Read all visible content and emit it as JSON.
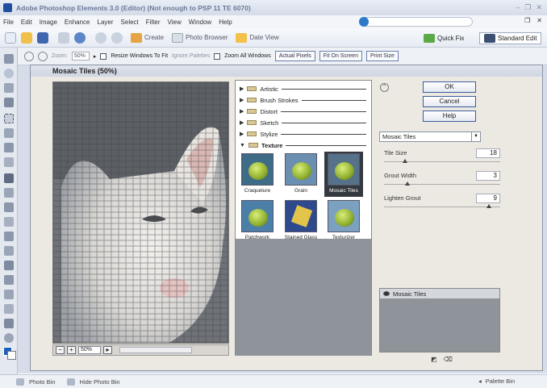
{
  "window": {
    "title": "Adobe Photoshop Elements 3.0 (Editor) (Not enough to PSP 11 TE 6070)"
  },
  "menu": [
    "File",
    "Edit",
    "Image",
    "Enhance",
    "Layer",
    "Select",
    "Filter",
    "View",
    "Window",
    "Help"
  ],
  "shortcuts": {
    "create_label": "Create",
    "photo_browser_label": "Photo Browser",
    "date_view_label": "Date View",
    "quick_fix_label": "Quick Fix",
    "standard_edit_label": "Standard Edit"
  },
  "options": {
    "zoom_label": "Zoom:",
    "zoom_value": "50%",
    "resize_windows_label": "Resize Windows To Fit",
    "ignore_palettes_label": "Ignore Palettes",
    "zoom_all_windows_label": "Zoom All Windows",
    "actual_pixels_label": "Actual Pixels",
    "fit_on_screen_label": "Fit On Screen",
    "print_size_label": "Print Size"
  },
  "dialog": {
    "title": "Mosaic Tiles (50%)",
    "preview_zoom": "50%",
    "categories": [
      "Artistic",
      "Brush Strokes",
      "Distort",
      "Sketch",
      "Stylize",
      "Texture"
    ],
    "thumbnails": [
      {
        "label": "Craquelure",
        "selected": false
      },
      {
        "label": "Grain",
        "selected": false
      },
      {
        "label": "Mosaic Tiles",
        "selected": true
      },
      {
        "label": "Patchwork",
        "selected": false
      },
      {
        "label": "Stained Glass",
        "selected": false
      },
      {
        "label": "Texturizer",
        "selected": false
      }
    ],
    "buttons": {
      "ok": "OK",
      "cancel": "Cancel",
      "help": "Help"
    },
    "filter_select": "Mosaic Tiles",
    "params": [
      {
        "label": "Tile Size",
        "value": "18",
        "level": 0.18
      },
      {
        "label": "Grout Width",
        "value": "3",
        "level": 0.2
      },
      {
        "label": "Lighten Grout",
        "value": "9",
        "level": 0.9
      }
    ],
    "effect_layer": "Mosaic Tiles"
  },
  "status": {
    "photo_bin": "Photo Bin",
    "hide_bin": "Hide Photo Bin",
    "palette_bin": "Palette Bin"
  },
  "colors": {
    "accent": "#1b5fb8",
    "selected_thumb": "#34393f"
  }
}
